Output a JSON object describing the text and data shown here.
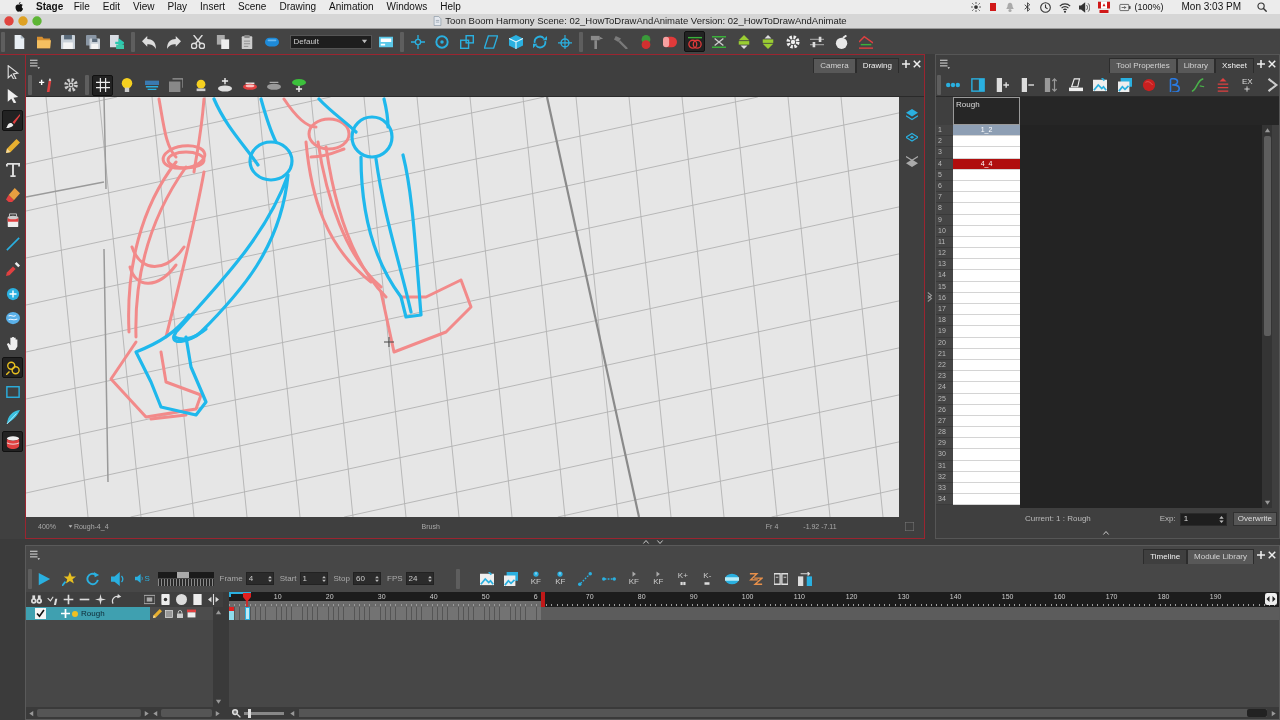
{
  "menu_bar": {
    "app": "Stage",
    "menus": [
      "File",
      "Edit",
      "View",
      "Play",
      "Insert",
      "Scene",
      "Drawing",
      "Animation",
      "Windows",
      "Help"
    ],
    "battery": "(100%)",
    "clock": "Mon 3:03 PM"
  },
  "window": {
    "title": "Toon Boom Harmony Scene: 02_HowToDrawAndAnimate Version: 02_HowToDrawAndAnimate"
  },
  "main_toolbar": {
    "preset": "Default",
    "buttons": [
      {
        "active": false
      },
      {
        "active": false
      },
      {
        "active": false
      },
      {
        "active": false
      },
      {
        "active": false
      },
      {
        "active": false
      },
      {
        "active": false
      },
      {
        "active": false
      },
      {
        "active": false
      },
      {
        "active": false
      },
      {
        "active": false
      },
      {
        "active": false
      },
      {
        "active": false
      },
      {
        "active": false
      },
      {
        "active": false
      },
      {
        "active": false
      },
      {
        "active": false
      },
      {
        "active": false
      },
      {
        "active": false
      },
      {
        "active": false
      },
      {
        "active": false
      },
      {
        "active": false
      },
      {
        "active": false
      },
      {
        "active": true
      },
      {
        "active": false
      },
      {
        "active": false
      },
      {
        "active": false
      },
      {
        "active": false
      },
      {
        "active": false
      },
      {
        "active": false
      },
      {
        "active": false
      }
    ]
  },
  "tools": [
    {
      "active": false
    },
    {
      "active": false
    },
    {
      "active": true
    },
    {
      "active": false
    },
    {
      "active": false
    },
    {
      "active": false
    },
    {
      "active": false
    },
    {
      "active": false
    },
    {
      "active": false
    },
    {
      "active": false
    },
    {
      "active": false
    },
    {
      "active": false
    },
    {
      "active": true
    },
    {
      "active": false
    },
    {
      "active": false
    },
    {
      "active": true
    }
  ],
  "drawing_view": {
    "tabs": [
      {
        "label": "Camera",
        "selected": false
      },
      {
        "label": "Drawing",
        "selected": true
      }
    ],
    "toolbar": [
      {
        "active": false
      },
      {
        "active": false
      },
      {
        "active": true
      },
      {
        "active": false
      },
      {
        "active": false
      },
      {
        "active": false
      },
      {
        "active": false
      },
      {
        "active": false
      },
      {
        "active": false
      },
      {
        "active": false
      },
      {
        "active": false
      }
    ],
    "status_bar": {
      "zoom": "400%",
      "drawing": "Rough-4_4",
      "tool": "Brush",
      "frame": "Fr 4",
      "coordinates": "-1.92 -7.11"
    }
  },
  "xsheet": {
    "tabs": [
      {
        "label": "Tool Properties",
        "selected": false
      },
      {
        "label": "Library",
        "selected": false
      },
      {
        "label": "Xsheet",
        "selected": true
      }
    ],
    "expose_label": "EX",
    "column": "Rough",
    "rows": [
      {
        "frame": "1",
        "cell": "1_2",
        "selected": true,
        "current": false
      },
      {
        "frame": "2",
        "selected": false,
        "current": false
      },
      {
        "frame": "3",
        "selected": false,
        "current": false
      },
      {
        "frame": "4",
        "cell": "4_4",
        "selected": false,
        "current": true
      },
      {
        "frame": "5",
        "selected": false,
        "current": false
      },
      {
        "frame": "6",
        "selected": false,
        "current": false
      },
      {
        "frame": "7",
        "selected": false,
        "current": false
      },
      {
        "frame": "8",
        "selected": false,
        "current": false
      },
      {
        "frame": "9",
        "selected": false,
        "current": false
      },
      {
        "frame": "10",
        "selected": false,
        "current": false
      },
      {
        "frame": "11",
        "selected": false,
        "current": false
      },
      {
        "frame": "12",
        "selected": false,
        "current": false
      },
      {
        "frame": "13",
        "selected": false,
        "current": false
      },
      {
        "frame": "14",
        "selected": false,
        "current": false
      },
      {
        "frame": "15",
        "selected": false,
        "current": false
      },
      {
        "frame": "16",
        "selected": false,
        "current": false
      },
      {
        "frame": "17",
        "selected": false,
        "current": false
      },
      {
        "frame": "18",
        "selected": false,
        "current": false
      },
      {
        "frame": "19",
        "selected": false,
        "current": false
      },
      {
        "frame": "20",
        "selected": false,
        "current": false
      },
      {
        "frame": "21",
        "selected": false,
        "current": false
      },
      {
        "frame": "22",
        "selected": false,
        "current": false
      },
      {
        "frame": "23",
        "selected": false,
        "current": false
      },
      {
        "frame": "24",
        "selected": false,
        "current": false
      },
      {
        "frame": "25",
        "selected": false,
        "current": false
      },
      {
        "frame": "26",
        "selected": false,
        "current": false
      },
      {
        "frame": "27",
        "selected": false,
        "current": false
      },
      {
        "frame": "28",
        "selected": false,
        "current": false
      },
      {
        "frame": "29",
        "selected": false,
        "current": false
      },
      {
        "frame": "30",
        "selected": false,
        "current": false
      },
      {
        "frame": "31",
        "selected": false,
        "current": false
      },
      {
        "frame": "32",
        "selected": false,
        "current": false
      },
      {
        "frame": "33",
        "selected": false,
        "current": false
      },
      {
        "frame": "34",
        "selected": false,
        "current": false
      }
    ],
    "current": "Current: 1 : Rough",
    "exposure_label": "Exp:",
    "exposure": "1",
    "mode_button": "Overwrite"
  },
  "timeline": {
    "tabs": [
      {
        "label": "Timeline",
        "selected": true
      },
      {
        "label": "Module Library",
        "selected": false
      }
    ],
    "scrub_label": "S",
    "speed": {
      "level": 0.45
    },
    "fields": [
      {
        "label": "Frame",
        "value": "4"
      },
      {
        "label": "Start",
        "value": "1"
      },
      {
        "label": "Stop",
        "value": "60"
      },
      {
        "label": "FPS",
        "value": "24"
      }
    ],
    "keyframe_buttons": [
      "KF",
      "KF",
      "KF",
      "KF",
      "K+",
      "K-"
    ],
    "layers": [
      {
        "name": "Rough",
        "checked": true,
        "selected": true
      }
    ],
    "ruler": [
      "10",
      "20",
      "30",
      "40",
      "50",
      "6",
      "70",
      "80",
      "90",
      "100",
      "110",
      "120",
      "130",
      "140",
      "150",
      "160",
      "170",
      "180",
      "190"
    ],
    "zoom_slider": {
      "level": 0.1
    }
  }
}
